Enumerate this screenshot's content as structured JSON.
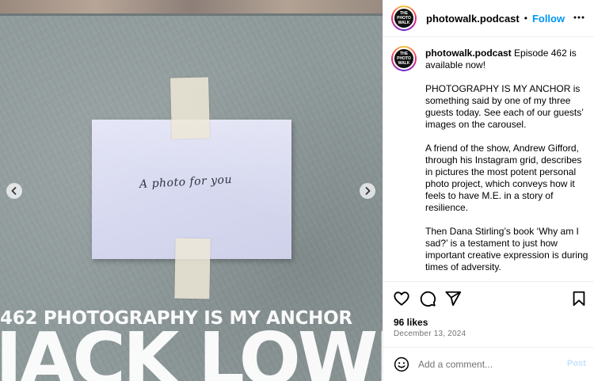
{
  "photo": {
    "handwriting": "A photo for you",
    "overlay_line1": "462 PHOTOGRAPHY IS MY ANCHOR",
    "overlay_line2": "JACK LOWE",
    "prev_icon": "chevron-left-icon",
    "next_icon": "chevron-right-icon"
  },
  "header": {
    "username": "photowalk.podcast",
    "separator": "•",
    "follow_label": "Follow",
    "more_icon": "ellipsis-icon",
    "more_label": "···",
    "avatar_text": "THE PHOTOWALK"
  },
  "caption": {
    "username": "photowalk.podcast",
    "paragraphs": [
      "Episode 462 is available now!",
      "PHOTOGRAPHY IS MY ANCHOR is something said by one of my three guests today. See each of our guests’ images on the carousel.",
      "A friend of the show, Andrew Gifford, through his Instagram grid, describes in pictures the most potent personal photo project, which conveys how it feels to have M.E. in a story of resilience.",
      "Then Dana Stirling’s book ‘Why am I sad?’ is a testament to just how important creative expression is during times of adversity."
    ]
  },
  "actions": {
    "like_icon": "heart-icon",
    "comment_icon": "comment-icon",
    "share_icon": "share-icon",
    "save_icon": "bookmark-icon"
  },
  "likes": "96 likes",
  "date": "December 13, 2024",
  "comment": {
    "emoji_icon": "emoji-icon",
    "placeholder": "Add a comment...",
    "post_label": "Post"
  },
  "colors": {
    "follow": "#0095f6",
    "post_disabled": "#c4e2fc",
    "muted": "#737373"
  }
}
